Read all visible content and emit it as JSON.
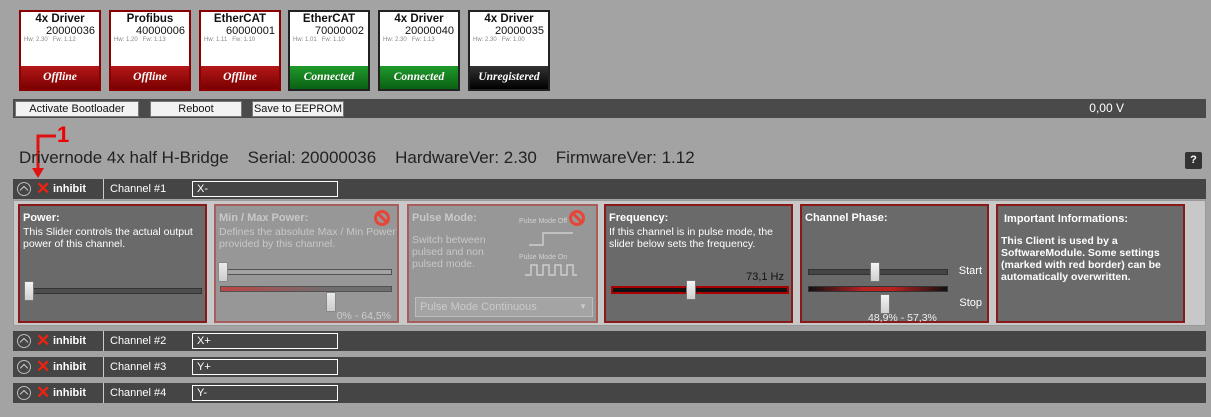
{
  "modules": [
    {
      "title": "4x Driver",
      "serial": "20000036",
      "hw": "Hw: 2.30",
      "fw": "Fw: 1.12",
      "status": "Offline",
      "status_color": "#9a0a0a"
    },
    {
      "title": "Profibus",
      "serial": "40000006",
      "hw": "Hw: 1.20",
      "fw": "Fw: 1.13",
      "status": "Offline",
      "status_color": "#9a0a0a"
    },
    {
      "title": "EtherCAT",
      "serial": "60000001",
      "hw": "Hw: 1.11",
      "fw": "Fw: 1.10",
      "status": "Offline",
      "status_color": "#9a0a0a"
    },
    {
      "title": "EtherCAT",
      "serial": "70000002",
      "hw": "Hw: 1.01",
      "fw": "Fw: 1.10",
      "status": "Connected",
      "status_color": "#148020"
    },
    {
      "title": "4x Driver",
      "serial": "20000040",
      "hw": "Hw: 2.30",
      "fw": "Fw: 1.13",
      "status": "Connected",
      "status_color": "#148020"
    },
    {
      "title": "4x Driver",
      "serial": "20000035",
      "hw": "Hw: 2.30",
      "fw": "Fw: 1.00",
      "status": "Unregistered",
      "status_color": "#000000"
    }
  ],
  "toolbar": {
    "activate_bootloader": "Activate Bootloader",
    "reboot": "Reboot",
    "save_eeprom": "Save to EEPROM",
    "voltage": "0,00 V"
  },
  "annotation": "1",
  "node": {
    "name": "Drivernode 4x half H-Bridge",
    "serial": "Serial: 20000036",
    "hardware": "HardwareVer: 2.30",
    "firmware": "FirmwareVer: 1.12",
    "help": "?"
  },
  "channels": [
    {
      "inhibit": "inhibit",
      "label": "Channel #1",
      "name": "X-"
    },
    {
      "inhibit": "inhibit",
      "label": "Channel #2",
      "name": "X+"
    },
    {
      "inhibit": "inhibit",
      "label": "Channel #3",
      "name": "Y+"
    },
    {
      "inhibit": "inhibit",
      "label": "Channel #4",
      "name": "Y-"
    }
  ],
  "channel1": {
    "power": {
      "title": "Power:",
      "text": "This Slider controls the actual output power of this channel.",
      "level": 0.0
    },
    "minmax": {
      "title": "Min / Max Power:",
      "text": "Defines the absolute Max / Min Power provided by this channel.",
      "range": "0% - 64,5%",
      "min_level": 0.0,
      "max_level": 0.645
    },
    "pulse": {
      "title": "Pulse Mode:",
      "text": "Switch between pulsed and non pulsed mode.",
      "pulse_mode_off": "Pulse Mode Off",
      "pulse_mode_on": "Pulse Mode On",
      "select_value": "Pulse Mode Continuous"
    },
    "frequency": {
      "title": "Frequency:",
      "text": "If this channel is in pulse mode, the slider below sets the frequency.",
      "value": "73,1 Hz"
    },
    "phase": {
      "title": "Channel Phase:",
      "start": "Start",
      "stop": "Stop",
      "range": "48,9% - 57,3%",
      "start_level": 0.489,
      "stop_level": 0.573
    },
    "info": {
      "title": "Important Informations:",
      "text": "This Client is used by a SoftwareModule. Some settings (marked with red border) can be automatically overwritten."
    }
  },
  "colors": {
    "offline": "#9a0a0a",
    "connected": "#148020",
    "accent_red": "#e21111"
  }
}
